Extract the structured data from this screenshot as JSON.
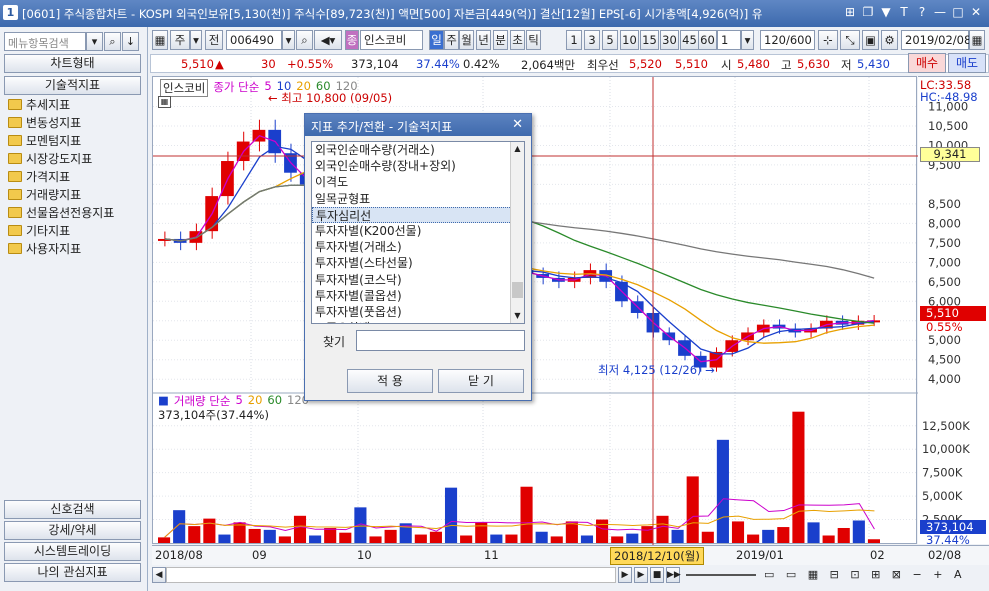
{
  "window": {
    "number": "1",
    "title": "[0601] 주식종합차트 - KOSPI 외국인보유[5,130(천)] 주식수[89,723(천)] 액면[500] 자본금[449(억)] 결산[12월] EPS[-6] 시가총액[4,926(억)] 유",
    "controls": [
      "⊞",
      "❐",
      "▼",
      "T",
      "?",
      "—",
      "□",
      "✕"
    ]
  },
  "sidebar": {
    "search_placeholder": "메뉴항목검색",
    "top_buttons": [
      "차트형태",
      "기술적지표"
    ],
    "tree": [
      "추세지표",
      "변동성지표",
      "모멘텀지표",
      "시장강도지표",
      "가격지표",
      "거래량지표",
      "선물옵션전용지표",
      "기타지표",
      "사용자지표"
    ],
    "bottom_buttons": [
      "신호검색",
      "강세/약세",
      "시스템트레이딩",
      "나의 관심지표"
    ]
  },
  "toolbar": {
    "mode": "주",
    "mode2": "전",
    "code": "006490",
    "badge": "종",
    "stock_name": "인스코비",
    "period_buttons": [
      "일",
      "주",
      "월",
      "년",
      "분",
      "초",
      "틱"
    ],
    "minute_buttons": [
      "1",
      "3",
      "5",
      "10",
      "15",
      "30",
      "45",
      "60"
    ],
    "interval": "1",
    "count": "120/600",
    "date": "2019/02/08"
  },
  "quote": {
    "price": "5,510",
    "change": "30",
    "change_pct": "+0.55%",
    "volume": "373,104",
    "volume_pct": "37.44%",
    "turnover": "0.42%",
    "amount": "2,064백만",
    "best_label": "최우선",
    "ask": "5,520",
    "bid": "5,510",
    "open_label": "시",
    "open": "5,480",
    "high_label": "고",
    "high": "5,630",
    "low_label": "저",
    "low": "5,430",
    "buy": "매수",
    "sell": "매도"
  },
  "price_panel": {
    "stock_label": "인스코비",
    "legend_prefix": "종가 단순",
    "ma": [
      "5",
      "10",
      "20",
      "60",
      "120"
    ],
    "ma_colors": [
      "#cc00cc",
      "#1a3fcc",
      "#e8a000",
      "#2a8a2a",
      "#777777"
    ],
    "high_note": "최고 10,800 (09/05)",
    "low_note": "최저 4,125 (12/26)",
    "lc": "LC:33.58",
    "hc": "HC:-48.98",
    "crosshair_value": "9,341",
    "last_value": "5,510",
    "last_pct": "0.55%"
  },
  "volume_panel": {
    "legend_prefix": "거래량 단순",
    "ma": [
      "5",
      "20",
      "60",
      "120"
    ],
    "current": "373,104주(37.44%)",
    "last_value": "373,104",
    "last_pct": "37.44%"
  },
  "xaxis": {
    "labels": [
      "2018/08",
      "09",
      "10",
      "11",
      "2019/01",
      "02",
      "02/08"
    ],
    "crosshair_date": "2018/12/10(월)"
  },
  "dialog": {
    "title": "지표 추가/전환 - 기술적지표",
    "items": [
      "외국인순매수량(거래소)",
      "외국인순매수량(장내+장외)",
      "이격도",
      "일목균형표",
      "투자심리선",
      "투자자별(K200선물)",
      "투자자별(거래소)",
      "투자자별(스타선물)",
      "투자자별(코스닥)",
      "투자자별(콜옵션)",
      "투자자별(풋옵션)",
      "표준오차밴드"
    ],
    "selected_index": 4,
    "find_label": "찾기",
    "apply": "적 용",
    "close": "닫 기"
  },
  "chart_data": [
    {
      "type": "candlestick",
      "ylim": [
        3800,
        11500
      ],
      "yticks": [
        4000,
        4500,
        5000,
        5500,
        6000,
        6500,
        7000,
        7500,
        8000,
        8500,
        9000,
        9500,
        10000,
        10500,
        11000
      ],
      "close": [
        7600,
        7500,
        7800,
        8700,
        9600,
        10100,
        10400,
        9800,
        9300,
        9000,
        8700,
        8500,
        8300,
        8000,
        7700,
        7400,
        7200,
        7000,
        6800,
        6700,
        6750,
        6900,
        6800,
        6700,
        6600,
        6500,
        6600,
        6800,
        6500,
        6000,
        5700,
        5200,
        5000,
        4600,
        4300,
        4700,
        5000,
        5200,
        5400,
        5300,
        5200,
        5300,
        5500,
        5400,
        5500,
        5510
      ]
    },
    {
      "type": "bar",
      "ylim": [
        0,
        14500
      ],
      "yticks": [
        2500,
        5000,
        7500,
        10000,
        12500
      ],
      "unit": "K",
      "values": [
        600,
        3500,
        1800,
        2600,
        900,
        2200,
        1500,
        1400,
        700,
        2900,
        800,
        1600,
        1100,
        3800,
        700,
        1400,
        2100,
        900,
        1200,
        5900,
        800,
        2200,
        900,
        900,
        6000,
        1200,
        700,
        2300,
        800,
        2500,
        700,
        1000,
        1800,
        2900,
        1400,
        7100,
        1200,
        11000,
        2300,
        900,
        1400,
        1700,
        14000,
        2200,
        800,
        1600,
        2400,
        400
      ]
    }
  ]
}
